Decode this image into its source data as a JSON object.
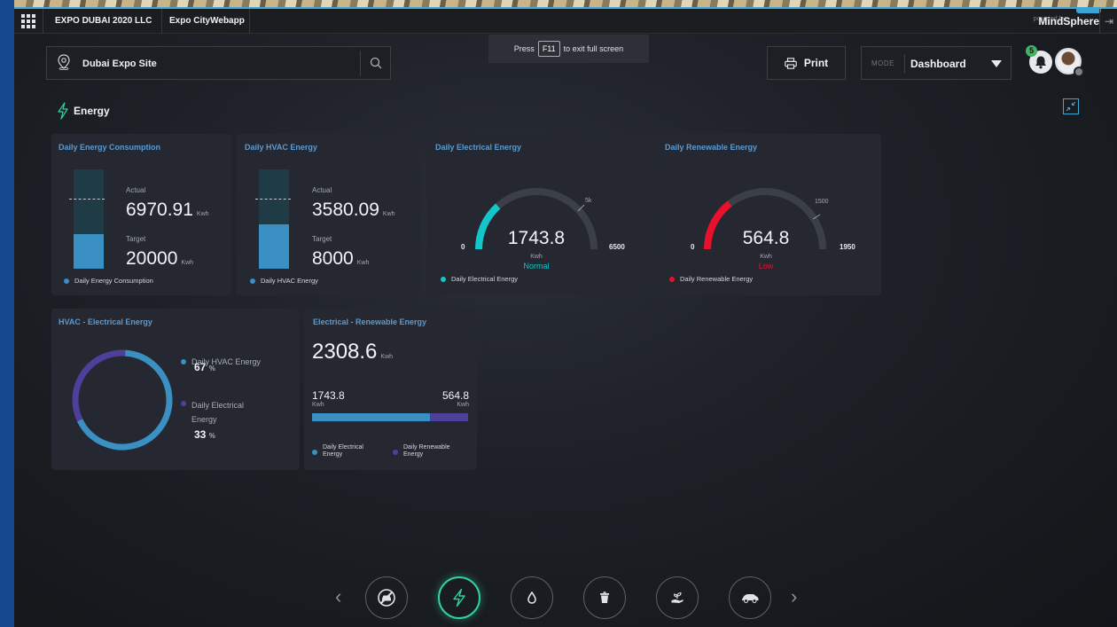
{
  "topbar": {
    "company": "EXPO DUBAI 2020 LLC",
    "app_name": "Expo CityWebapp",
    "powered_by": "powered by",
    "brand": "MindSphere"
  },
  "fullscreen_toast": {
    "prefix": "Press",
    "key": "F11",
    "suffix": "to exit full screen"
  },
  "header": {
    "location": "Dubai Expo Site",
    "print_label": "Print",
    "mode_label": "MODE",
    "mode_value": "Dashboard",
    "notification_count": "5"
  },
  "section": {
    "title": "Energy"
  },
  "cards": {
    "daily_energy": {
      "title": "Daily Energy Consumption",
      "actual_label": "Actual",
      "actual_value": "6970.91",
      "actual_unit": "Kwh",
      "target_label": "Target",
      "target_value": "20000",
      "target_unit": "Kwh",
      "legend": "Daily Energy Consumption",
      "fill_fraction": 0.35
    },
    "daily_hvac": {
      "title": "Daily HVAC Energy",
      "actual_label": "Actual",
      "actual_value": "3580.09",
      "actual_unit": "Kwh",
      "target_label": "Target",
      "target_value": "8000",
      "target_unit": "Kwh",
      "legend": "Daily HVAC Energy",
      "fill_fraction": 0.45
    },
    "daily_electrical": {
      "title": "Daily Electrical Energy",
      "value": "1743.8",
      "unit": "Kwh",
      "status": "Normal",
      "min": "0",
      "max": "6500",
      "tick": "5k",
      "legend": "Daily Electrical Energy",
      "fraction": 0.268,
      "color": "#12c7cc"
    },
    "daily_renewable": {
      "title": "Daily Renewable Energy",
      "value": "564.8",
      "unit": "Kwh",
      "status": "Low",
      "min": "0",
      "max": "1950",
      "tick": "1500",
      "legend": "Daily Renewable Energy",
      "fraction": 0.29,
      "color": "#e8102b"
    },
    "hvac_electrical": {
      "title": "HVAC - Electrical Energy",
      "items": [
        {
          "label": "Daily HVAC Energy",
          "value": "67",
          "unit": "%",
          "color": "#3a8fc3"
        },
        {
          "label": "Daily Electrical Energy",
          "value": "33",
          "unit": "%",
          "color": "#4d3f9a"
        }
      ]
    },
    "electrical_renewable": {
      "title": "Electrical - Renewable Energy",
      "total": "2308.6",
      "total_unit": "Kwh",
      "left_value": "1743.8",
      "left_unit": "Kwh",
      "right_value": "564.8",
      "right_unit": "Kwh",
      "left_fraction": 0.755,
      "legend_left": "Daily Electrical Energy",
      "legend_right": "Daily Renewable Energy",
      "color_left": "#3a8fc3",
      "color_right": "#4d3f9a"
    }
  },
  "bottom_nav": {
    "items": [
      "no-car-icon",
      "energy-icon",
      "water-drop-icon",
      "waste-bin-icon",
      "plant-hand-icon",
      "vehicle-icon"
    ],
    "active": "energy-icon"
  }
}
